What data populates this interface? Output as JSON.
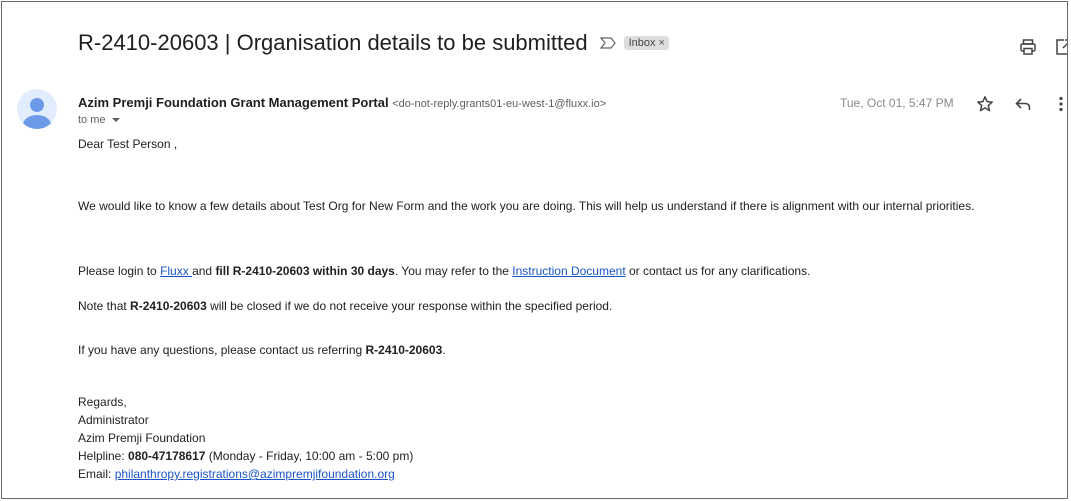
{
  "header": {
    "subject": "R-2410-20603 | Organisation details to be submitted",
    "label": "Inbox",
    "label_close": "×"
  },
  "message": {
    "sender_name": "Azim Premji Foundation Grant Management Portal",
    "sender_email": "<do-not-reply.grants01-eu-west-1@fluxx.io>",
    "to": "to me",
    "date": "Tue, Oct 01, 5:47 PM"
  },
  "body": {
    "greeting": "Dear Test Person ,",
    "para1": "We would like to know a few details about Test Org for New Form and the work you are doing. This will help us understand if there is alignment with our internal priorities.",
    "para2": {
      "pre": "Please login to ",
      "link1": "Fluxx ",
      "mid1": "and ",
      "bold1": "fill R-2410-20603 within 30 days",
      "mid2": ". You may refer to the ",
      "link2": "Instruction Document",
      "post": " or contact us for any clarifications."
    },
    "para3": {
      "pre": "Note that ",
      "bold": "R-2410-20603",
      "post": " will be closed if we do not receive your response within the specified period."
    },
    "para4": {
      "pre": "If you have any questions, please contact us referring ",
      "bold": "R-2410-20603",
      "post": "."
    }
  },
  "signature": {
    "regards": "Regards,",
    "role": "Administrator",
    "org": "Azim Premji Foundation",
    "helpline_label": "Helpline: ",
    "helpline_number": "080-47178617",
    "helpline_hours": " (Monday - Friday, 10:00 am - 5:00 pm)",
    "email_label": "Email: ",
    "email": "philanthropy.registrations@azimpremjifoundation.org"
  },
  "icons": {
    "importance": "importance-marker-icon",
    "print": "print-icon",
    "open_new": "open-in-new-window-icon",
    "avatar": "avatar-person-icon",
    "star": "star-icon",
    "reply": "reply-icon",
    "more": "more-vertical-icon"
  },
  "colors": {
    "link": "#1a55c8",
    "avatar_bg": "#e1ecfc",
    "avatar_fg": "#6c9ae8",
    "label_chip_bg": "#dddddd"
  }
}
